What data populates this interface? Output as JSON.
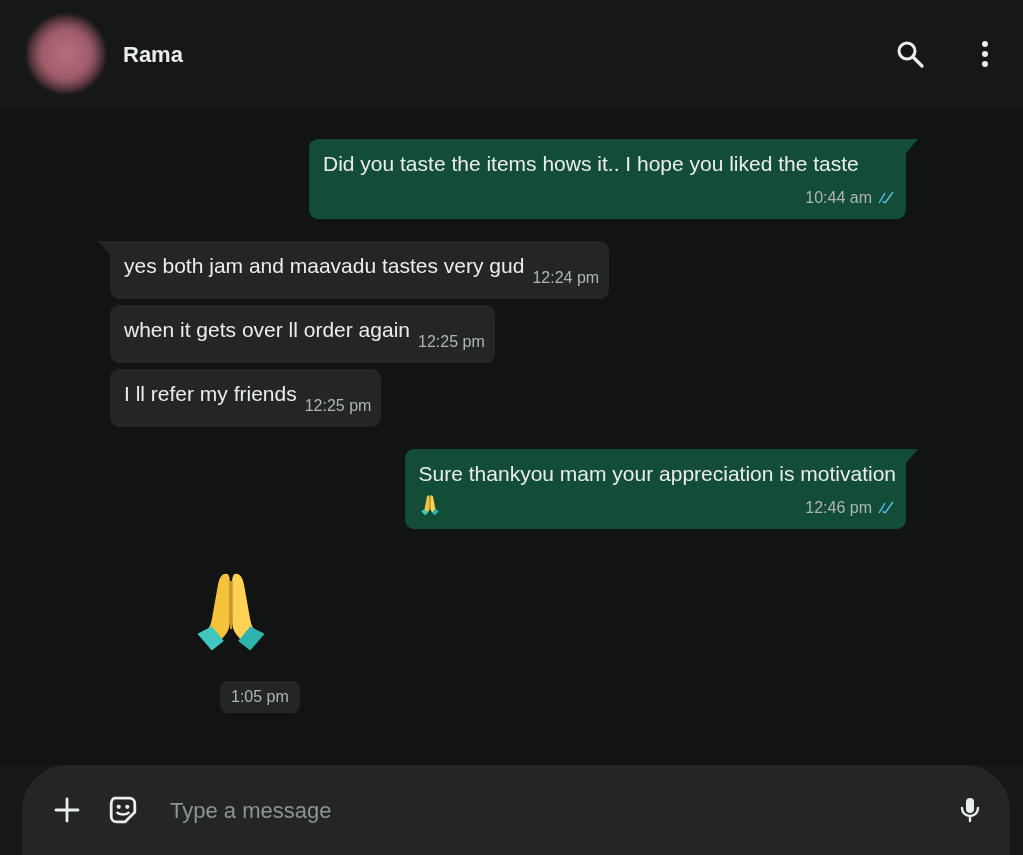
{
  "header": {
    "contact_name": "Rama"
  },
  "messages": [
    {
      "kind": "text",
      "outgoing": true,
      "tail": true,
      "text": "Did you taste the items hows it.. I hope you liked the taste",
      "time": "10:44 am",
      "read": true,
      "trailing_emoji": false
    },
    {
      "kind": "text",
      "outgoing": false,
      "tail": true,
      "text": "yes both jam and maavadu tastes very gud",
      "time": "12:24 pm"
    },
    {
      "kind": "text",
      "outgoing": false,
      "tail": false,
      "text": "when it gets over  ll order again",
      "time": "12:25 pm"
    },
    {
      "kind": "text",
      "outgoing": false,
      "tail": false,
      "text": "I  ll refer my friends",
      "time": "12:25 pm"
    },
    {
      "kind": "text",
      "outgoing": true,
      "tail": true,
      "text": "Sure thankyou mam your appreciation is motivation",
      "time": "12:46 pm",
      "read": true,
      "trailing_emoji": true
    },
    {
      "kind": "emoji",
      "outgoing": false,
      "time": "1:05 pm"
    }
  ],
  "composer": {
    "placeholder": "Type a message"
  }
}
